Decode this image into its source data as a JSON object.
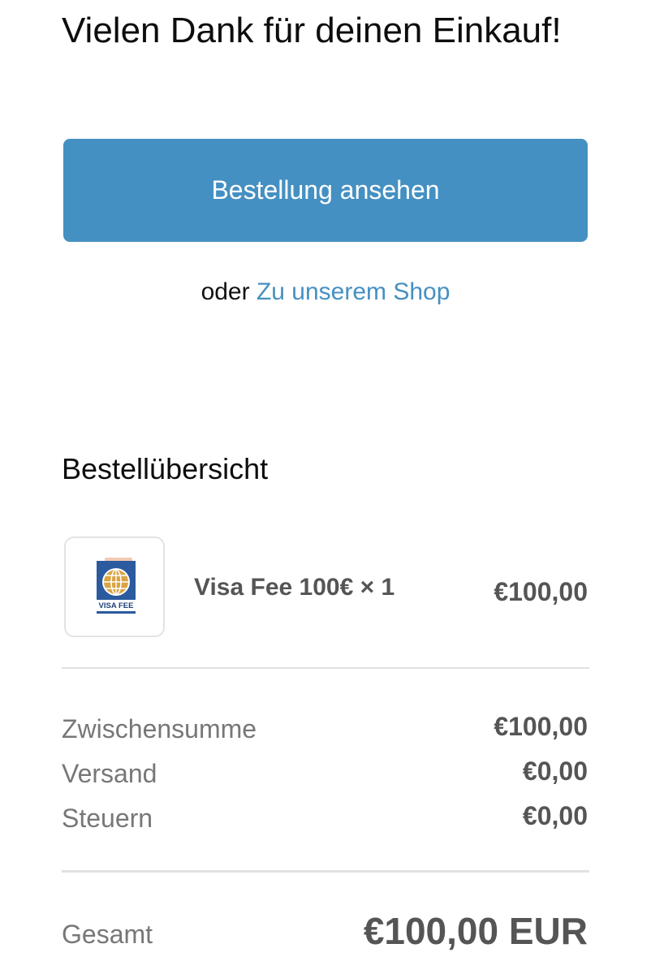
{
  "confirmation": {
    "heading": "Vielen Dank für deinen Einkauf!",
    "view_order_button": "Bestellung ansehen",
    "or_text": "oder",
    "shop_link": "Zu unserem Shop"
  },
  "summary": {
    "title": "Bestellübersicht",
    "items": [
      {
        "name": "Visa Fee 100€ × 1",
        "price": "€100,00",
        "thumbnail_text": "VISA FEE",
        "thumbnail_icon": "globe-passport-icon"
      }
    ],
    "rows": [
      {
        "label": "Zwischensumme",
        "value": "€100,00"
      },
      {
        "label": "Versand",
        "value": "€0,00"
      },
      {
        "label": "Steuern",
        "value": "€0,00"
      }
    ],
    "total": {
      "label": "Gesamt",
      "value": "€100,00 EUR"
    }
  },
  "colors": {
    "accent": "#4590c2",
    "passport_blue": "#2b5a9e",
    "passport_gold": "#d9a441"
  }
}
